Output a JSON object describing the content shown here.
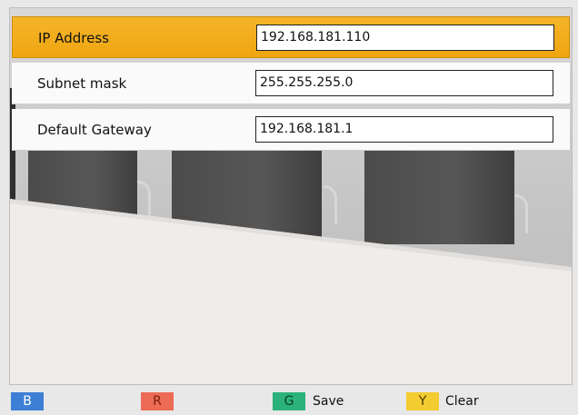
{
  "fields": [
    {
      "label": "IP Address",
      "value": "192.168.181.110",
      "selected": true
    },
    {
      "label": "Subnet mask",
      "value": "255.255.255.0",
      "selected": false
    },
    {
      "label": "Default Gateway",
      "value": "192.168.181.1",
      "selected": false
    }
  ],
  "footer": {
    "blue_key": "B",
    "red_key": "R",
    "green_key": "G",
    "green_label": "Save",
    "yellow_key": "Y",
    "yellow_label": "Clear"
  },
  "colors": {
    "selected_row": "#f2ad1c",
    "blue_key": "#3d7fd4",
    "red_key": "#ec6b55",
    "green_key": "#2bb27b",
    "yellow_key": "#f3cc31"
  }
}
